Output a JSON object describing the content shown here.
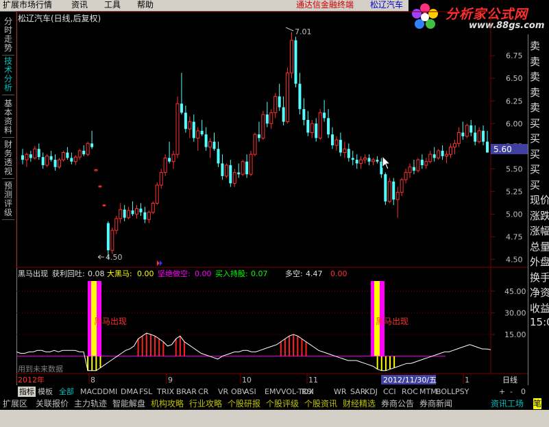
{
  "menu": {
    "items": [
      "扩展市场行情",
      "资讯",
      "工具",
      "帮助"
    ],
    "ad_text": "通达信金融终端",
    "stock_link": "松辽汽车"
  },
  "logo": {
    "text": "分析家公式网",
    "url": "www.88gs.com"
  },
  "left_tabs": [
    "分时走势",
    "技术分析",
    "基本资料",
    "财务透视",
    "预测评级"
  ],
  "main_chart": {
    "title": "松辽汽车(日线,后复权)",
    "high_label": "7.01",
    "low_label": "4.50",
    "current_price": "5.60",
    "y_ticks": [
      "6.75",
      "6.50",
      "6.25",
      "6.00",
      "5.75",
      "5.50",
      "5.25",
      "5.00",
      "4.75",
      "4.50"
    ]
  },
  "indicator": {
    "name": "黑马出现",
    "fields": [
      {
        "label": "获利回吐:",
        "value": "0.08"
      },
      {
        "label": "大黑马:",
        "value": "0.00"
      },
      {
        "label": "坚绝做空:",
        "value": "0.00"
      },
      {
        "label": "买入持股:",
        "value": "0.07"
      },
      {
        "label": "多空:",
        "value": "4.47"
      },
      {
        "label": "",
        "value": "0.00"
      }
    ],
    "signal_label_1": "黑马出现",
    "signal_label_2": "黑马出现",
    "y_ticks": [
      "45.00",
      "30.00",
      "15.00"
    ],
    "watermark": "用到未来数据"
  },
  "x_axis": {
    "labels": [
      "2012年",
      "8",
      "9",
      "10",
      "11",
      "1"
    ],
    "highlight": "2012/11/30/五",
    "period": "日线"
  },
  "right_panel": {
    "items": [
      "卖",
      "卖",
      "卖",
      "卖",
      "卖",
      "买",
      "买",
      "买",
      "买",
      "买",
      "现价",
      "涨跌",
      "涨幅",
      "总量",
      "外盘",
      "换手",
      "净资",
      "收益",
      "15:0"
    ]
  },
  "indicator_tabs": {
    "items": [
      "指标",
      "模板",
      "全部",
      "MACD",
      "DMI",
      "DMA",
      "FSL",
      "TRIX",
      "BRAR",
      "CR",
      "VR",
      "OBV",
      "ASI",
      "EMV",
      "VOL-TDX",
      "RSI",
      "WR",
      "SAR",
      "KDJ",
      "CCI",
      "ROC",
      "MTM",
      "BOLL",
      "PSY"
    ],
    "controls": [
      "+",
      "-",
      "0"
    ]
  },
  "function_tabs": {
    "items": [
      "扩展区",
      "关联报价",
      "主力轨迹",
      "智能解盘",
      "机构攻略",
      "行业攻略",
      "个股研报",
      "个股评级",
      "个股资讯",
      "财经精选",
      "券商公告",
      "券商新闻"
    ],
    "right_item": "资讯工场",
    "right_edge": "笔"
  },
  "colors": {
    "up": "#ff3232",
    "down": "#54ffff",
    "bg": "#000000",
    "grid": "#800000",
    "price_tag": "#4040a0",
    "signal_magenta": "#ff00ff",
    "signal_yellow": "#ffff00"
  },
  "chart_data": {
    "type": "candlestick",
    "title": "松辽汽车(日线,后复权)",
    "y_range": [
      4.45,
      7.1
    ],
    "high": 7.01,
    "low": 4.5,
    "last": 5.6,
    "ohlc": [
      [
        5.65,
        5.72,
        5.55,
        5.6
      ],
      [
        5.6,
        5.68,
        5.52,
        5.66
      ],
      [
        5.66,
        5.7,
        5.58,
        5.62
      ],
      [
        5.62,
        5.75,
        5.6,
        5.72
      ],
      [
        5.72,
        5.78,
        5.6,
        5.63
      ],
      [
        5.63,
        5.68,
        5.5,
        5.54
      ],
      [
        5.54,
        5.66,
        5.52,
        5.64
      ],
      [
        5.64,
        5.7,
        5.58,
        5.6
      ],
      [
        5.6,
        5.66,
        5.48,
        5.52
      ],
      [
        5.52,
        5.62,
        5.5,
        5.6
      ],
      [
        5.6,
        5.7,
        5.58,
        5.68
      ],
      [
        5.68,
        5.74,
        5.6,
        5.62
      ],
      [
        5.62,
        5.68,
        5.55,
        5.58
      ],
      [
        5.58,
        5.65,
        5.54,
        5.63
      ],
      [
        5.63,
        5.72,
        5.6,
        5.7
      ],
      [
        5.7,
        5.76,
        5.64,
        5.66
      ],
      [
        5.66,
        5.8,
        5.64,
        5.78
      ],
      [
        5.78,
        5.92,
        5.72,
        5.74
      ],
      [
        5.48,
        5.5,
        5.47,
        5.49
      ],
      [
        5.3,
        5.32,
        5.29,
        5.31
      ],
      [
        5.1,
        5.11,
        5.08,
        5.1
      ],
      [
        4.9,
        4.92,
        4.5,
        4.6
      ],
      [
        4.6,
        4.85,
        4.56,
        4.82
      ],
      [
        4.82,
        4.98,
        4.78,
        4.95
      ],
      [
        4.95,
        5.12,
        4.9,
        5.05
      ],
      [
        5.05,
        5.1,
        4.92,
        4.96
      ],
      [
        4.96,
        5.08,
        4.94,
        5.04
      ],
      [
        5.04,
        5.14,
        4.98,
        5.0
      ],
      [
        5.0,
        5.1,
        4.95,
        5.06
      ],
      [
        5.06,
        5.12,
        4.98,
        5.02
      ],
      [
        5.02,
        5.08,
        4.9,
        4.94
      ],
      [
        4.94,
        5.04,
        4.9,
        5.02
      ],
      [
        5.02,
        5.14,
        5.0,
        5.12
      ],
      [
        5.12,
        5.35,
        5.1,
        5.32
      ],
      [
        5.32,
        5.5,
        5.28,
        5.46
      ],
      [
        5.46,
        5.66,
        5.42,
        5.62
      ],
      [
        5.62,
        5.8,
        5.56,
        5.58
      ],
      [
        5.58,
        5.7,
        5.5,
        5.66
      ],
      [
        5.66,
        6.3,
        5.62,
        6.22
      ],
      [
        6.22,
        6.56,
        6.1,
        6.12
      ],
      [
        6.12,
        6.2,
        5.9,
        5.94
      ],
      [
        5.94,
        6.08,
        5.84,
        6.02
      ],
      [
        6.02,
        6.1,
        5.8,
        5.84
      ],
      [
        5.84,
        5.96,
        5.7,
        5.92
      ],
      [
        5.92,
        6.04,
        5.86,
        5.88
      ],
      [
        5.88,
        5.96,
        5.7,
        5.74
      ],
      [
        5.74,
        5.84,
        5.62,
        5.8
      ],
      [
        5.8,
        5.9,
        5.7,
        5.72
      ],
      [
        5.72,
        5.8,
        5.52,
        5.56
      ],
      [
        5.56,
        5.66,
        5.38,
        5.42
      ],
      [
        5.42,
        5.56,
        5.4,
        5.54
      ],
      [
        5.54,
        5.6,
        5.3,
        5.34
      ],
      [
        5.34,
        5.5,
        5.3,
        5.46
      ],
      [
        5.46,
        5.56,
        5.4,
        5.44
      ],
      [
        5.44,
        5.6,
        5.42,
        5.58
      ],
      [
        5.58,
        5.66,
        5.4,
        5.44
      ],
      [
        5.44,
        5.7,
        5.42,
        5.66
      ],
      [
        5.66,
        5.9,
        5.64,
        5.88
      ],
      [
        5.88,
        6.02,
        5.8,
        5.84
      ],
      [
        5.84,
        6.14,
        5.82,
        6.1
      ],
      [
        6.1,
        6.24,
        5.96,
        6.0
      ],
      [
        6.0,
        6.16,
        5.94,
        6.12
      ],
      [
        6.12,
        6.34,
        6.06,
        6.3
      ],
      [
        6.3,
        6.44,
        6.14,
        6.18
      ],
      [
        6.18,
        6.3,
        5.98,
        6.02
      ],
      [
        6.02,
        6.62,
        6.0,
        6.56
      ],
      [
        6.56,
        7.01,
        6.5,
        6.92
      ],
      [
        6.92,
        6.96,
        6.4,
        6.44
      ],
      [
        6.44,
        6.56,
        6.1,
        6.16
      ],
      [
        6.16,
        6.28,
        5.98,
        6.04
      ],
      [
        6.04,
        6.14,
        5.86,
        5.9
      ],
      [
        5.9,
        6.04,
        5.84,
        6.0
      ],
      [
        6.0,
        6.06,
        5.8,
        5.84
      ],
      [
        5.84,
        6.16,
        5.82,
        6.12
      ],
      [
        6.12,
        6.26,
        6.02,
        6.06
      ],
      [
        6.06,
        6.16,
        5.84,
        5.88
      ],
      [
        5.88,
        5.96,
        5.72,
        5.76
      ],
      [
        5.76,
        5.86,
        5.7,
        5.82
      ],
      [
        5.82,
        5.9,
        5.64,
        5.68
      ],
      [
        5.68,
        5.8,
        5.62,
        5.72
      ],
      [
        5.72,
        5.78,
        5.58,
        5.62
      ],
      [
        5.62,
        5.7,
        5.54,
        5.6
      ],
      [
        5.6,
        5.66,
        5.5,
        5.56
      ],
      [
        5.56,
        5.64,
        5.5,
        5.6
      ],
      [
        5.6,
        5.66,
        5.56,
        5.62
      ],
      [
        5.62,
        5.66,
        5.54,
        5.58
      ],
      [
        5.58,
        5.62,
        5.54,
        5.6
      ],
      [
        5.6,
        5.64,
        5.56,
        5.58
      ],
      [
        5.58,
        5.62,
        5.4,
        5.44
      ],
      [
        5.44,
        5.46,
        5.1,
        5.14
      ],
      [
        5.14,
        5.4,
        5.12,
        5.36
      ],
      [
        5.36,
        5.4,
        5.1,
        5.16
      ],
      [
        5.16,
        5.3,
        4.96,
        5.24
      ],
      [
        5.24,
        5.4,
        5.2,
        5.38
      ],
      [
        5.38,
        5.5,
        5.34,
        5.46
      ],
      [
        5.46,
        5.56,
        5.4,
        5.52
      ],
      [
        5.52,
        5.6,
        5.44,
        5.48
      ],
      [
        5.48,
        5.62,
        5.46,
        5.6
      ],
      [
        5.6,
        5.66,
        5.5,
        5.54
      ],
      [
        5.54,
        5.62,
        5.5,
        5.58
      ],
      [
        5.58,
        5.7,
        5.56,
        5.66
      ],
      [
        5.66,
        5.74,
        5.58,
        5.62
      ],
      [
        5.62,
        5.72,
        5.6,
        5.7
      ],
      [
        5.7,
        5.76,
        5.6,
        5.64
      ],
      [
        5.64,
        5.7,
        5.56,
        5.66
      ],
      [
        5.66,
        5.78,
        5.62,
        5.74
      ],
      [
        5.74,
        5.82,
        5.66,
        5.78
      ],
      [
        5.78,
        5.96,
        5.74,
        5.9
      ],
      [
        5.9,
        6.02,
        5.82,
        5.86
      ],
      [
        5.86,
        6.0,
        5.84,
        5.98
      ],
      [
        5.98,
        6.04,
        5.86,
        5.9
      ],
      [
        5.9,
        5.98,
        5.76,
        5.8
      ],
      [
        5.8,
        5.96,
        5.78,
        5.92
      ],
      [
        5.92,
        5.98,
        5.76,
        5.8
      ],
      [
        5.8,
        5.92,
        5.74,
        5.68
      ]
    ],
    "indicator_series": {
      "name": "多空",
      "values": [
        3,
        2,
        2,
        3,
        3,
        4,
        4,
        3,
        3,
        4,
        3,
        4,
        4,
        4,
        4,
        3,
        3,
        -10,
        -10,
        -10,
        -8,
        -6,
        -4,
        -2,
        0,
        2,
        4,
        5,
        7,
        12,
        14,
        16,
        15,
        14,
        12,
        10,
        7,
        8,
        12,
        14,
        10,
        8,
        6,
        4,
        2,
        1,
        0,
        -1,
        -2,
        0,
        1,
        2,
        3,
        3,
        4,
        4,
        3,
        3,
        4,
        5,
        6,
        7,
        8,
        10,
        12,
        14,
        15,
        14,
        12,
        10,
        8,
        6,
        4,
        3,
        2,
        1,
        0,
        -1,
        -2,
        -3,
        -3,
        -3,
        -4,
        -5,
        -6,
        -7,
        -9,
        -10,
        -10,
        -9,
        -8,
        -7,
        -6,
        -5,
        -5,
        -4,
        -3,
        -2,
        -1,
        0,
        1,
        2,
        3,
        3,
        4,
        5,
        6,
        7,
        8,
        7,
        6,
        5,
        5,
        4.47
      ]
    },
    "y2_range": [
      -12,
      52
    ],
    "y2_ticks": [
      45,
      30,
      15
    ]
  }
}
